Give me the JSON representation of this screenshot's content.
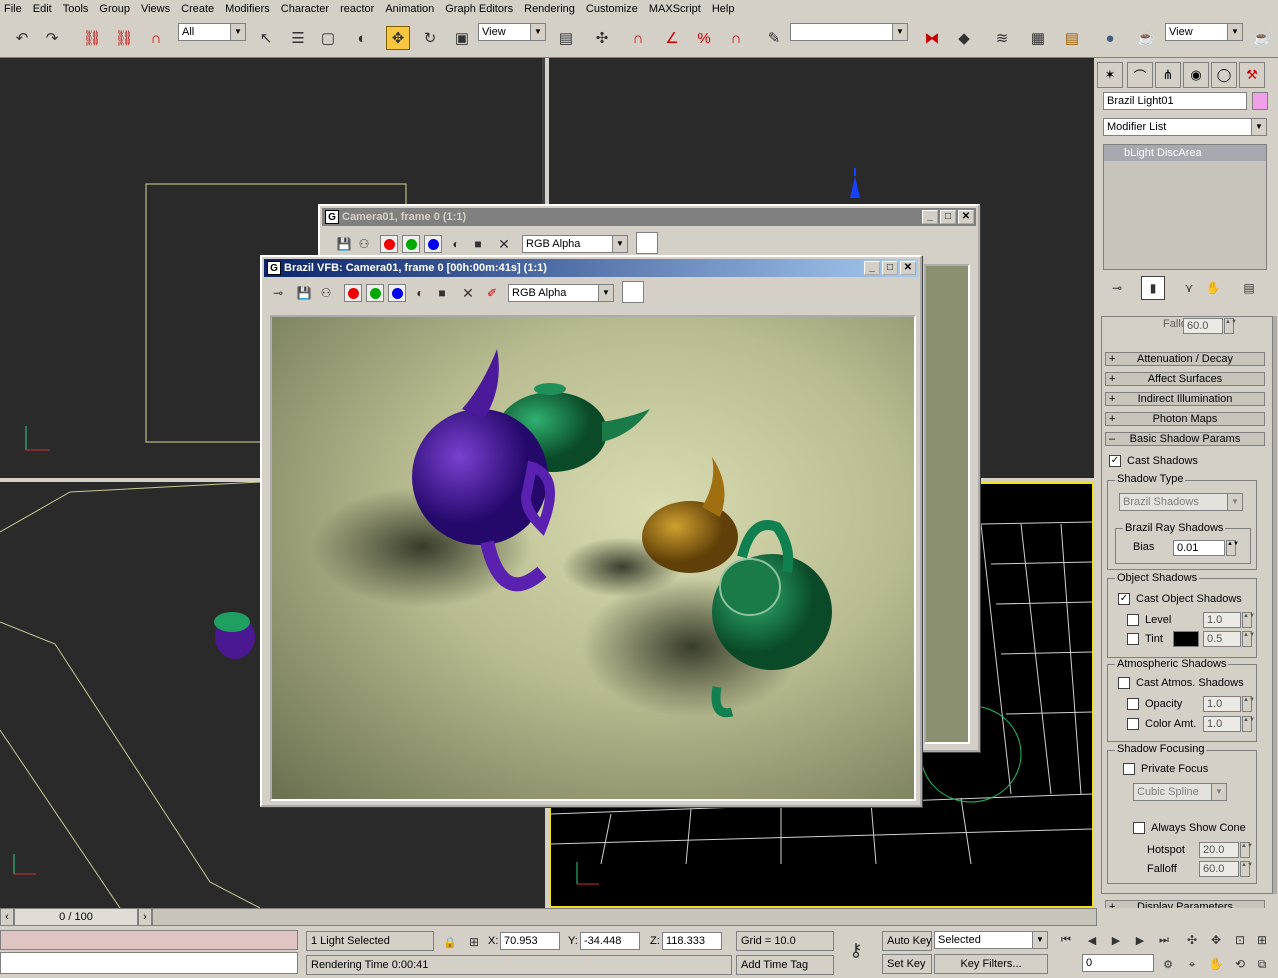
{
  "menu": [
    "File",
    "Edit",
    "Tools",
    "Group",
    "Views",
    "Create",
    "Modifiers",
    "Character",
    "reactor",
    "Animation",
    "Graph Editors",
    "Rendering",
    "Customize",
    "MAXScript",
    "Help"
  ],
  "toolbar": {
    "selection_filter": "All",
    "ref_coord_1": "View",
    "named_sel": "",
    "ref_coord_2": "View"
  },
  "command_panel": {
    "object_name": "Brazil Light01",
    "object_color": "#f0a0e8",
    "modifier_list": "Modifier List",
    "stack_item": "bLight DiscArea",
    "falloff_top_label": "Falloff",
    "falloff_top_value": "60.0",
    "rollouts": [
      {
        "sign": "+",
        "label": "Attenuation / Decay"
      },
      {
        "sign": "+",
        "label": "Affect Surfaces"
      },
      {
        "sign": "+",
        "label": "Indirect Illumination"
      },
      {
        "sign": "+",
        "label": "Photon Maps"
      },
      {
        "sign": "–",
        "label": "Basic Shadow Params"
      }
    ],
    "cast_shadows": "Cast Shadows",
    "shadow_type_group": "Shadow Type",
    "shadow_type_value": "Brazil Shadows",
    "ray_shadows_group": "Brazil Ray Shadows",
    "bias_label": "Bias",
    "bias_value": "0.01",
    "object_shadows_group": "Object Shadows",
    "cast_object_shadows": "Cast Object Shadows",
    "level_label": "Level",
    "level_value": "1.0",
    "tint_label": "Tint",
    "tint_value": "0.5",
    "atmos_group": "Atmospheric Shadows",
    "cast_atmos": "Cast Atmos. Shadows",
    "opacity_label": "Opacity",
    "opacity_value": "1.0",
    "color_amt_label": "Color Amt.",
    "color_amt_value": "1.0",
    "focus_group": "Shadow Focusing",
    "private_focus": "Private Focus",
    "spline_value": "Cubic Spline",
    "always_show_cone": "Always Show Cone",
    "hotspot_label": "Hotspot",
    "hotspot_value": "20.0",
    "falloff_label": "Falloff",
    "falloff_value": "60.0",
    "display_params": "Display Parameters"
  },
  "window_back": {
    "title": "Camera01, frame 0 (1:1)",
    "channel": "RGB Alpha"
  },
  "window_front": {
    "title": "Brazil VFB: Camera01, frame 0 [00h:00m:41s] (1:1)",
    "channel": "RGB Alpha"
  },
  "status": {
    "timeline": "0 / 100",
    "selection": "1 Light Selected",
    "x_label": "X:",
    "x_value": "70.953",
    "y_label": "Y:",
    "y_value": "-34.448",
    "z_label": "Z:",
    "z_value": "118.333",
    "grid": "Grid = 10.0",
    "rendering_time": "Rendering Time  0:00:41",
    "add_time_tag": "Add Time Tag",
    "auto_key": "Auto Key",
    "set_key": "Set Key",
    "selected": "Selected",
    "key_filters": "Key Filters...",
    "frame": "0"
  }
}
